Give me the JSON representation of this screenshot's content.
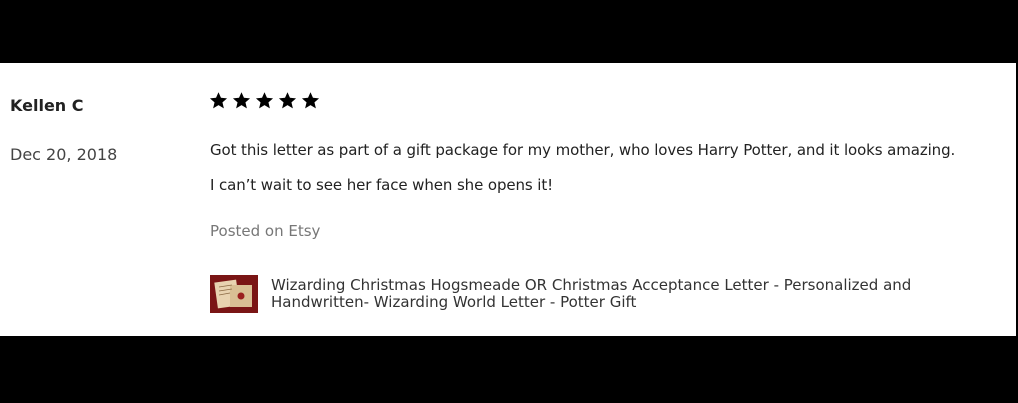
{
  "review": {
    "reviewer": "Kellen C",
    "date": "Dec 20, 2018",
    "rating": 5,
    "max_rating": 5,
    "text_line_1": "Got this letter as part of a gift package for my mother, who loves Harry Potter, and it looks amazing.",
    "text_line_2": "I can’t wait to see her face when she opens it!",
    "source": "Posted on Etsy"
  },
  "product": {
    "title": "Wizarding Christmas Hogsmeade OR Christmas Acceptance Letter - Personalized and Handwritten- Wizarding World Letter - Potter Gift",
    "thumbnail_icon": "letter-thumbnail"
  },
  "colors": {
    "background": "#000000",
    "card": "#ffffff",
    "star": "#000000",
    "muted_text": "#777777",
    "thumbnail_bg": "#8b1a1a"
  }
}
